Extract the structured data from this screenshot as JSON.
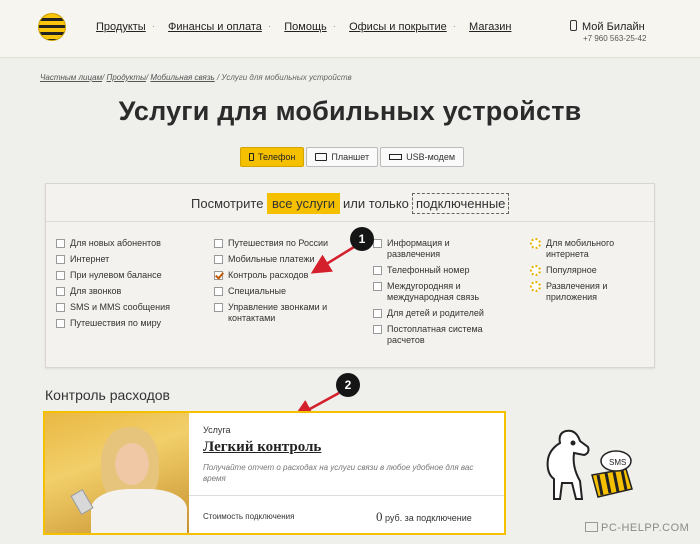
{
  "header": {
    "nav": [
      {
        "label": "Продукты"
      },
      {
        "label": "Финансы и оплата"
      },
      {
        "label": "Помощь"
      },
      {
        "label": "Офисы и покрытие"
      },
      {
        "label": "Магазин"
      }
    ],
    "my_account": "Мой Билайн",
    "phone": "+7 960 563-25-42"
  },
  "breadcrumb": {
    "items": [
      "Частным лицам",
      "Продукты",
      "Мобильная связь"
    ],
    "current": "Услуги для мобильных устройств"
  },
  "page_title": "Услуги для мобильных устройств",
  "tabs": [
    {
      "label": "Телефон",
      "active": true
    },
    {
      "label": "Планшет",
      "active": false
    },
    {
      "label": "USB-модем",
      "active": false
    }
  ],
  "filter": {
    "lead": "Посмотрите",
    "all_label": "все услуги",
    "or_label": "или только",
    "connected_label": "подключенные",
    "columns": [
      [
        {
          "label": "Для новых абонентов",
          "checked": false
        },
        {
          "label": "Интернет",
          "checked": false
        },
        {
          "label": "При нулевом балансе",
          "checked": false
        },
        {
          "label": "Для звонков",
          "checked": false
        },
        {
          "label": "SMS и MMS сообщения",
          "checked": false
        },
        {
          "label": "Путешествия по миру",
          "checked": false
        }
      ],
      [
        {
          "label": "Путешествия по России",
          "checked": false
        },
        {
          "label": "Мобильные платежи",
          "checked": false
        },
        {
          "label": "Контроль расходов",
          "checked": true
        },
        {
          "label": "Специальные",
          "checked": false
        },
        {
          "label": "Управление звонками и контактами",
          "checked": false
        }
      ],
      [
        {
          "label": "Информация и развлечения",
          "checked": false
        },
        {
          "label": "Телефонный номер",
          "checked": false
        },
        {
          "label": "Междугородняя и международная связь",
          "checked": false
        },
        {
          "label": "Для детей и родителей",
          "checked": false
        },
        {
          "label": "Постоплатная система расчетов",
          "checked": false
        }
      ],
      [
        {
          "label": "Для мобильного интернета",
          "icon": "gear-icon"
        },
        {
          "label": "Популярное",
          "icon": "gear-icon"
        },
        {
          "label": "Развлечения и приложения",
          "icon": "gear-icon"
        }
      ]
    ]
  },
  "markers": [
    "1",
    "2"
  ],
  "section_title": "Контроль расходов",
  "service_card": {
    "kind": "Услуга",
    "name": "Легкий контроль",
    "description": "Получайте отчет о расходах на услуги связи в любое удобное для вас время",
    "cost_label": "Стоимость подключения",
    "price_value": "0",
    "price_unit": "руб. за подключение"
  },
  "illustration": {
    "sms_label": "SMS"
  },
  "watermark": "PC-HELPP.COM",
  "colors": {
    "accent": "#f5c000",
    "marker": "#151515",
    "arrow": "#d3202c"
  }
}
